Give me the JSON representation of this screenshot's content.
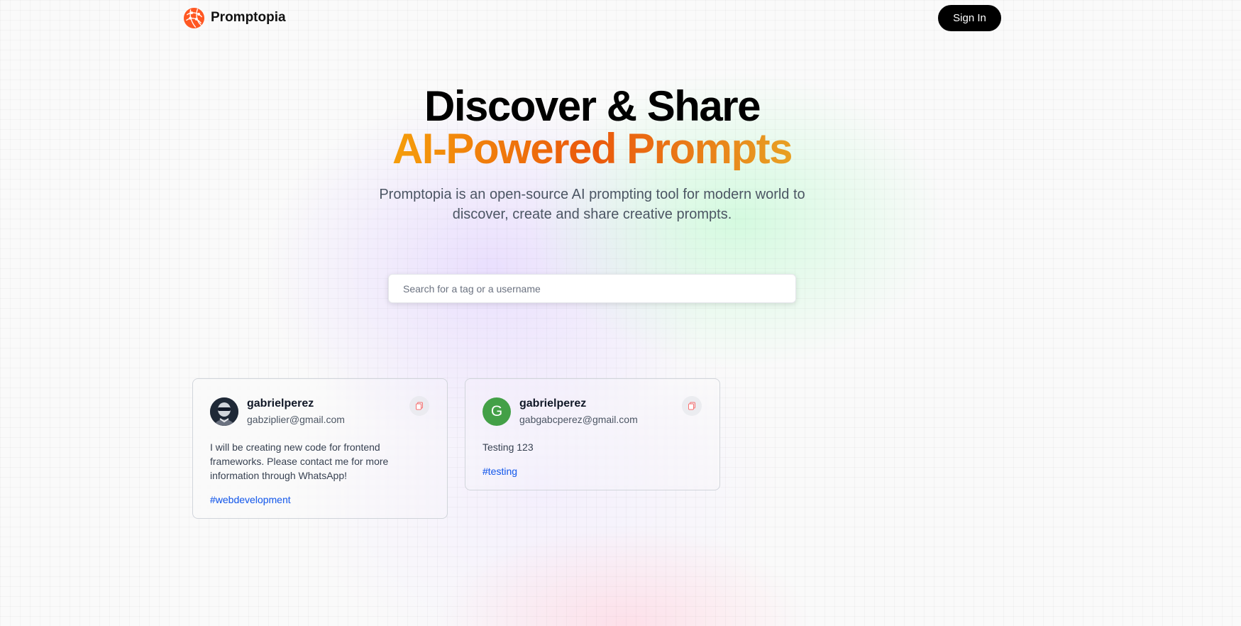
{
  "nav": {
    "brand_name": "Promptopia",
    "sign_in_label": "Sign In"
  },
  "hero": {
    "title_line1": "Discover & Share",
    "title_line2": "AI-Powered Prompts",
    "description": "Promptopia is an open-source AI prompting tool for modern world to discover, create and share creative prompts."
  },
  "search": {
    "value": "",
    "placeholder": "Search for a tag or a username"
  },
  "prompts": [
    {
      "username": "gabrielperez",
      "email": "gabziplier@gmail.com",
      "avatar": "photo",
      "prompt": "I will be creating new code for frontend frameworks. Please contact me for more information through WhatsApp!",
      "tag": "#webdevelopment"
    },
    {
      "username": "gabrielperez",
      "email": "gabgabcperez@gmail.com",
      "avatar": "letter",
      "avatar_letter": "G",
      "prompt": "Testing 123",
      "tag": "#testing"
    }
  ],
  "colors": {
    "accent_gradient": [
      "#f59e0b",
      "#ea580c",
      "#e8a023"
    ],
    "tag_blue": "#2563eb",
    "avatar_green": "#43a047",
    "sign_in_bg": "#000000"
  },
  "icons": {
    "brand": "promptopia-logo-icon",
    "copy": "copy-icon"
  }
}
